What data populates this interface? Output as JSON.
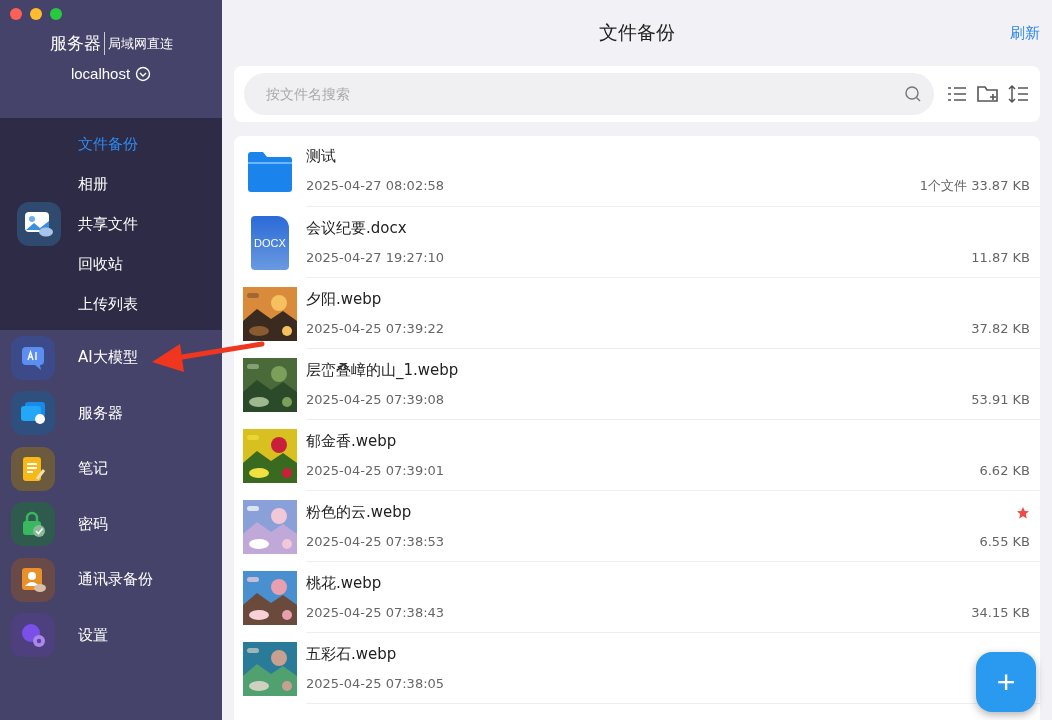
{
  "sidebar": {
    "server_title": "服务器",
    "server_mode": "局域网直连",
    "host": "localhost",
    "items": [
      {
        "expanded": true,
        "children": [
          {
            "label": "文件备份",
            "selected": true
          },
          {
            "label": "相册",
            "selected": false
          },
          {
            "label": "共享文件",
            "selected": false
          },
          {
            "label": "回收站",
            "selected": false
          },
          {
            "label": "上传列表",
            "selected": false
          }
        ]
      },
      {
        "label": "AI大模型",
        "expanded": false
      },
      {
        "label": "服务器",
        "expanded": false
      },
      {
        "label": "笔记",
        "expanded": false
      },
      {
        "label": "密码",
        "expanded": false
      },
      {
        "label": "通讯录备份",
        "expanded": false
      },
      {
        "label": "设置",
        "expanded": false
      }
    ]
  },
  "header": {
    "title": "文件备份",
    "refresh": "刷新"
  },
  "search": {
    "placeholder": "按文件名搜索"
  },
  "files": [
    {
      "kind": "folder",
      "name": "测试",
      "date": "2025-04-27 08:02:58",
      "size": "1个文件 33.87 KB",
      "starred": false
    },
    {
      "kind": "docx",
      "badge": "DOCX",
      "name": "会议纪要.docx",
      "date": "2025-04-27 19:27:10",
      "size": "11.87 KB",
      "starred": false
    },
    {
      "kind": "picture",
      "name": "夕阳.webp",
      "date": "2025-04-25 07:39:22",
      "size": "37.82 KB",
      "starred": false
    },
    {
      "kind": "picture",
      "name": "层峦叠嶂的山_1.webp",
      "date": "2025-04-25 07:39:08",
      "size": "53.91 KB",
      "starred": false
    },
    {
      "kind": "picture",
      "name": "郁金香.webp",
      "date": "2025-04-25 07:39:01",
      "size": "6.62 KB",
      "starred": false
    },
    {
      "kind": "picture",
      "name": "粉色的云.webp",
      "date": "2025-04-25 07:38:53",
      "size": "6.55 KB",
      "starred": true
    },
    {
      "kind": "picture",
      "name": "桃花.webp",
      "date": "2025-04-25 07:38:43",
      "size": "34.15 KB",
      "starred": false
    },
    {
      "kind": "picture",
      "name": "五彩石.webp",
      "date": "2025-04-25 07:38:05",
      "starred": false
    }
  ],
  "fab": "+"
}
